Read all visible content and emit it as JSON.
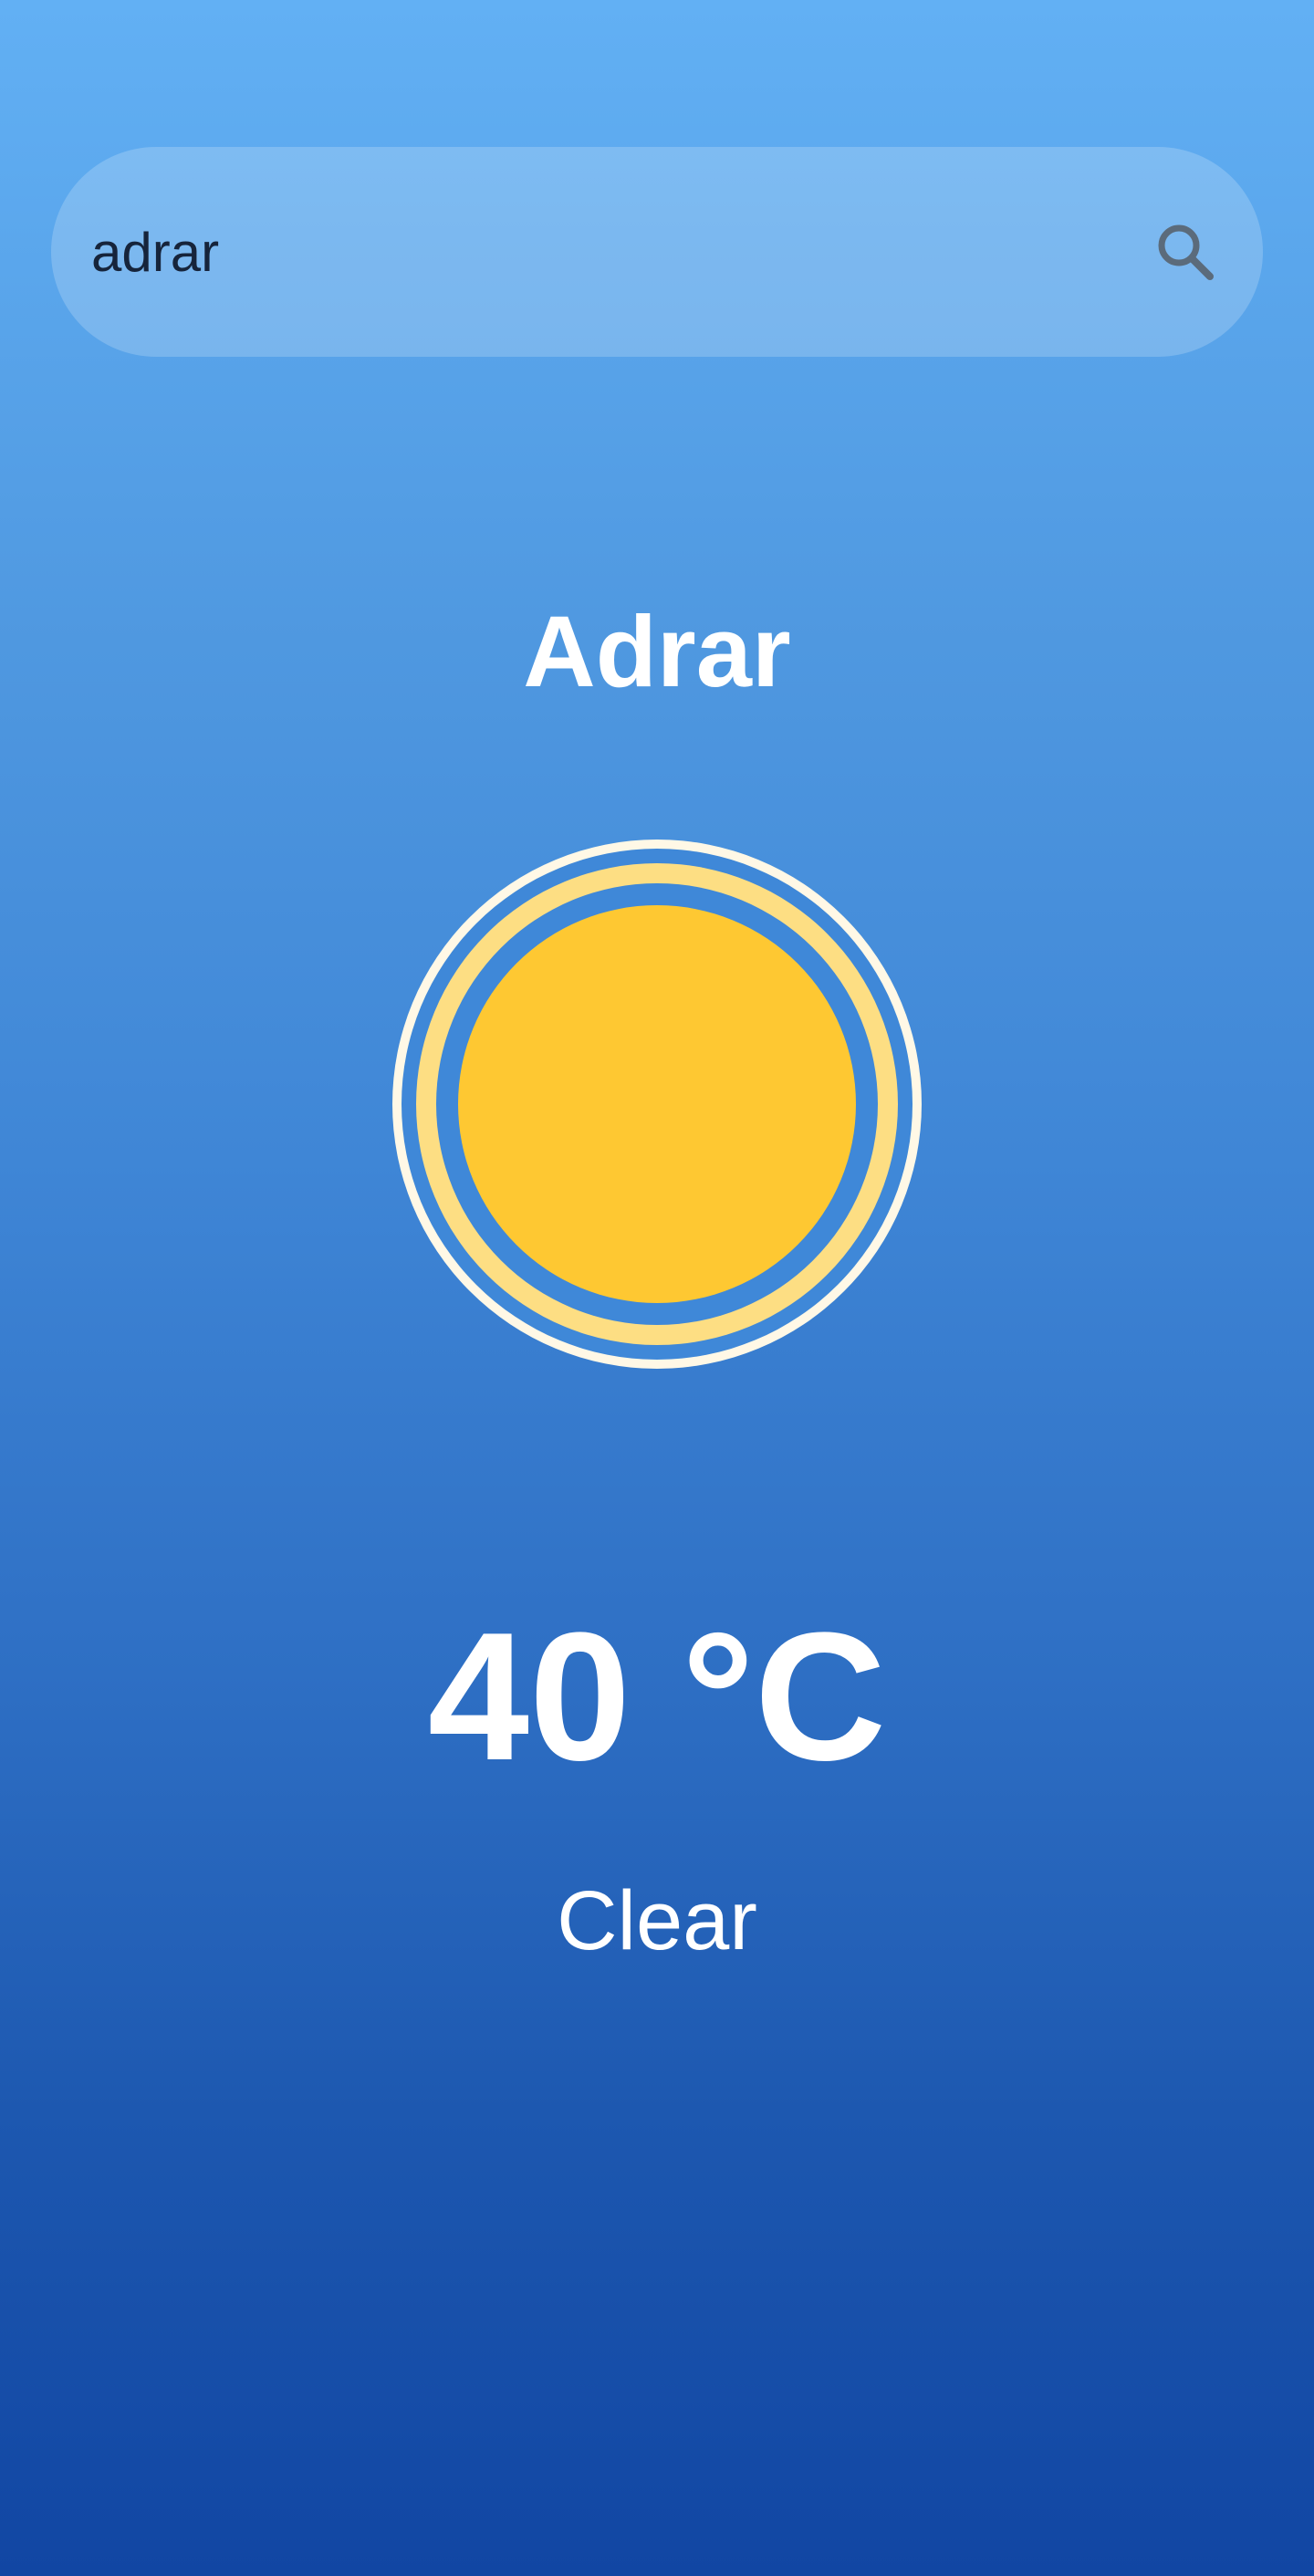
{
  "search": {
    "value": "adrar",
    "icon": "search-icon"
  },
  "weather": {
    "city": "Adrar",
    "temperature": "40 °C",
    "condition": "Clear",
    "icon": "sun-icon"
  },
  "colors": {
    "gradient_top": "#62b0f4",
    "gradient_bottom": "#1146a3",
    "sun_core": "#fec832",
    "sun_ring": "#fdde83",
    "sun_outer_ring": "#fff8e6",
    "search_icon": "#5b6b7b"
  }
}
